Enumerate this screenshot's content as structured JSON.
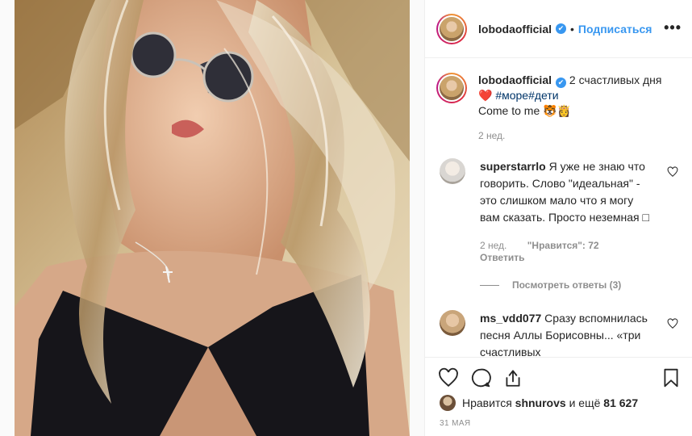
{
  "post_header": {
    "username": "lobodaofficial",
    "verified_mark": "✔",
    "separator": "•",
    "follow_label": "Подписаться",
    "more_label": "•••"
  },
  "caption": {
    "username": "lobodaofficial",
    "verified_mark": "✔",
    "text_1": "2 счастливых дня",
    "emoji_heart": "❤️",
    "hashtags": "#море#дети",
    "text_2": "Come to me",
    "emoji_end": "🐯👸",
    "time": "2 нед."
  },
  "comments": [
    {
      "username": "superstarrlo",
      "text": "Я уже не знаю что говорить. Слово \"идеальная\" - это слишком мало что я могу вам сказать. Просто неземная □",
      "time": "2 нед.",
      "likes": "\"Нравится\": 72",
      "reply_label": "Ответить"
    },
    {
      "username": "ms_vdd077",
      "text": "Сразу вспомнилась песня Аллы Борисовны... «три счастливых"
    }
  ],
  "view_replies_label": "Посмотреть ответы (3)",
  "likes": {
    "liked_prefix": "Нравится",
    "liked_user": "shnurovs",
    "liked_suffix": "и ещё",
    "count": "81 627"
  },
  "date": "31 МАЯ",
  "icons": {
    "like": "heart-icon",
    "comment": "comment-icon",
    "share": "share-icon",
    "save": "bookmark-icon",
    "more": "more-icon",
    "verified": "verified-icon"
  },
  "colors": {
    "link_blue": "#3897f0",
    "hashtag": "#003569",
    "meta_gray": "#8e8e8e",
    "text": "#262626",
    "heart_red": "#e53935"
  }
}
